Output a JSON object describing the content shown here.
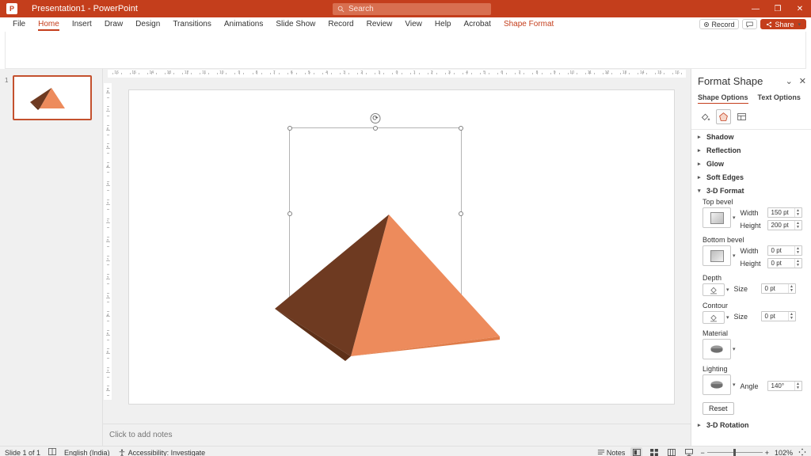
{
  "app": {
    "logo_glyph": "P",
    "title": "Presentation1  -  PowerPoint"
  },
  "search": {
    "placeholder": "Search",
    "icon": "search-icon"
  },
  "window_controls": {
    "minimize": "—",
    "restore": "❐",
    "close": "✕"
  },
  "ribbon": {
    "tabs": [
      {
        "label": "File",
        "state": "normal"
      },
      {
        "label": "Home",
        "state": "active"
      },
      {
        "label": "Insert",
        "state": "normal"
      },
      {
        "label": "Draw",
        "state": "normal"
      },
      {
        "label": "Design",
        "state": "normal"
      },
      {
        "label": "Transitions",
        "state": "normal"
      },
      {
        "label": "Animations",
        "state": "normal"
      },
      {
        "label": "Slide Show",
        "state": "normal"
      },
      {
        "label": "Record",
        "state": "normal"
      },
      {
        "label": "Review",
        "state": "normal"
      },
      {
        "label": "View",
        "state": "normal"
      },
      {
        "label": "Help",
        "state": "normal"
      },
      {
        "label": "Acrobat",
        "state": "normal"
      },
      {
        "label": "Shape Format",
        "state": "contextual"
      }
    ],
    "record_label": "Record",
    "comments_label": "",
    "share_label": "Share"
  },
  "slides_panel": {
    "slide_number": "1"
  },
  "rulers": {
    "horizontal_labels": [
      "16",
      "15",
      "14",
      "13",
      "12",
      "11",
      "10",
      "9",
      "8",
      "7",
      "6",
      "5",
      "4",
      "3",
      "2",
      "1",
      "0",
      "1",
      "2",
      "3",
      "4",
      "5",
      "6",
      "7",
      "8",
      "9",
      "10",
      "11",
      "12",
      "13",
      "14",
      "15",
      "16"
    ],
    "vertical_labels": [
      "8",
      "7",
      "6",
      "5",
      "4",
      "3",
      "2",
      "1",
      "0",
      "1",
      "2",
      "3",
      "4",
      "5",
      "6",
      "7",
      "8"
    ]
  },
  "notes": {
    "placeholder": "Click to add notes"
  },
  "shape": {
    "name": "pyramid-3d",
    "light_face_color": "#ED8B5C",
    "dark_face_color": "#6E3A21",
    "mid_face_color": "#E98552"
  },
  "format_pane": {
    "title": "Format Shape",
    "collapse_icon": "⌄",
    "close_icon": "✕",
    "tabs": [
      {
        "label": "Shape Options",
        "active": true
      },
      {
        "label": "Text Options",
        "active": false
      }
    ],
    "icon_tabs": [
      {
        "name": "fill-line-icon",
        "active": false
      },
      {
        "name": "effects-pentagon-icon",
        "active": true
      },
      {
        "name": "size-properties-icon",
        "active": false
      }
    ],
    "sections": [
      {
        "label": "Shadow",
        "expanded": false
      },
      {
        "label": "Reflection",
        "expanded": false
      },
      {
        "label": "Glow",
        "expanded": false
      },
      {
        "label": "Soft Edges",
        "expanded": false
      },
      {
        "label": "3-D Format",
        "expanded": true
      },
      {
        "label": "3-D Rotation",
        "expanded": false
      }
    ],
    "three_d_format": {
      "top_bevel": {
        "label": "Top bevel",
        "width_label": "Width",
        "width_value": "150 pt",
        "height_label": "Height",
        "height_value": "200 pt"
      },
      "bottom_bevel": {
        "label": "Bottom bevel",
        "width_label": "Width",
        "width_value": "0 pt",
        "height_label": "Height",
        "height_value": "0 pt"
      },
      "depth": {
        "label": "Depth",
        "size_label": "Size",
        "size_value": "0 pt"
      },
      "contour": {
        "label": "Contour",
        "size_label": "Size",
        "size_value": "0 pt"
      },
      "material": {
        "label": "Material"
      },
      "lighting": {
        "label": "Lighting",
        "angle_label": "Angle",
        "angle_value": "140°"
      },
      "reset_label": "Reset"
    }
  },
  "statusbar": {
    "slide_count": "Slide 1 of 1",
    "language": "English (India)",
    "accessibility": "Accessibility: Investigate",
    "notes_label": "Notes",
    "zoom_percent": "102%",
    "zoom_out": "−",
    "zoom_in": "+"
  }
}
